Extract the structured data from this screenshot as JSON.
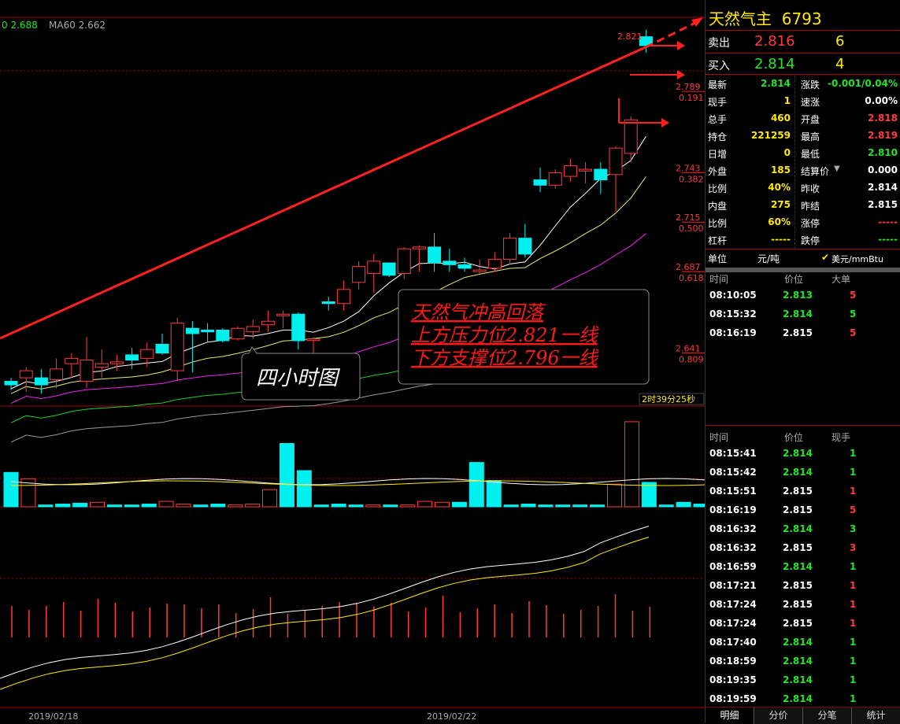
{
  "main_chart": {
    "ma_legend": [
      {
        "label": "0 2.688",
        "color": "#27e327"
      },
      {
        "label": "MA60 2.662",
        "color": "#aaaaaa"
      }
    ],
    "candles": [
      {
        "o": 2.624,
        "h": 2.626,
        "l": 2.619,
        "c": 2.622
      },
      {
        "o": 2.626,
        "h": 2.632,
        "l": 2.618,
        "c": 2.63
      },
      {
        "o": 2.626,
        "h": 2.631,
        "l": 2.617,
        "c": 2.622
      },
      {
        "o": 2.625,
        "h": 2.637,
        "l": 2.62,
        "c": 2.631
      },
      {
        "o": 2.634,
        "h": 2.64,
        "l": 2.626,
        "c": 2.637
      },
      {
        "o": 2.624,
        "h": 2.649,
        "l": 2.62,
        "c": 2.636
      },
      {
        "o": 2.632,
        "h": 2.642,
        "l": 2.626,
        "c": 2.634
      },
      {
        "o": 2.634,
        "h": 2.639,
        "l": 2.63,
        "c": 2.635
      },
      {
        "o": 2.639,
        "h": 2.643,
        "l": 2.631,
        "c": 2.636
      },
      {
        "o": 2.637,
        "h": 2.646,
        "l": 2.632,
        "c": 2.642
      },
      {
        "o": 2.645,
        "h": 2.651,
        "l": 2.639,
        "c": 2.64
      },
      {
        "o": 2.63,
        "h": 2.66,
        "l": 2.624,
        "c": 2.657
      },
      {
        "o": 2.654,
        "h": 2.658,
        "l": 2.629,
        "c": 2.651
      },
      {
        "o": 2.653,
        "h": 2.657,
        "l": 2.646,
        "c": 2.652
      },
      {
        "o": 2.653,
        "h": 2.654,
        "l": 2.646,
        "c": 2.647
      },
      {
        "o": 2.648,
        "h": 2.655,
        "l": 2.647,
        "c": 2.654
      },
      {
        "o": 2.652,
        "h": 2.659,
        "l": 2.648,
        "c": 2.655
      },
      {
        "o": 2.656,
        "h": 2.664,
        "l": 2.652,
        "c": 2.658
      },
      {
        "o": 2.662,
        "h": 2.664,
        "l": 2.654,
        "c": 2.662
      },
      {
        "o": 2.662,
        "h": 2.663,
        "l": 2.642,
        "c": 2.647
      },
      {
        "o": 2.648,
        "h": 2.649,
        "l": 2.639,
        "c": 2.648
      },
      {
        "o": 2.669,
        "h": 2.672,
        "l": 2.664,
        "c": 2.668
      },
      {
        "o": 2.668,
        "h": 2.681,
        "l": 2.664,
        "c": 2.676
      },
      {
        "o": 2.68,
        "h": 2.692,
        "l": 2.676,
        "c": 2.689
      },
      {
        "o": 2.685,
        "h": 2.696,
        "l": 2.674,
        "c": 2.692
      },
      {
        "o": 2.691,
        "h": 2.69,
        "l": 2.683,
        "c": 2.684
      },
      {
        "o": 2.685,
        "h": 2.7,
        "l": 2.682,
        "c": 2.699
      },
      {
        "o": 2.699,
        "h": 2.701,
        "l": 2.686,
        "c": 2.7
      },
      {
        "o": 2.7,
        "h": 2.708,
        "l": 2.686,
        "c": 2.691
      },
      {
        "o": 2.692,
        "h": 2.699,
        "l": 2.686,
        "c": 2.69
      },
      {
        "o": 2.69,
        "h": 2.694,
        "l": 2.686,
        "c": 2.688
      },
      {
        "o": 2.687,
        "h": 2.693,
        "l": 2.685,
        "c": 2.687
      },
      {
        "o": 2.688,
        "h": 2.697,
        "l": 2.686,
        "c": 2.693
      },
      {
        "o": 2.693,
        "h": 2.708,
        "l": 2.69,
        "c": 2.705
      },
      {
        "o": 2.705,
        "h": 2.713,
        "l": 2.694,
        "c": 2.696
      },
      {
        "o": 2.738,
        "h": 2.745,
        "l": 2.731,
        "c": 2.735
      },
      {
        "o": 2.735,
        "h": 2.744,
        "l": 2.733,
        "c": 2.742
      },
      {
        "o": 2.74,
        "h": 2.75,
        "l": 2.737,
        "c": 2.746
      },
      {
        "o": 2.743,
        "h": 2.748,
        "l": 2.736,
        "c": 2.744
      },
      {
        "o": 2.744,
        "h": 2.748,
        "l": 2.73,
        "c": 2.738
      },
      {
        "o": 2.741,
        "h": 2.757,
        "l": 2.72,
        "c": 2.756
      },
      {
        "o": 2.753,
        "h": 2.774,
        "l": 2.748,
        "c": 2.772
      },
      {
        "o": 2.819,
        "h": 2.823,
        "l": 2.81,
        "c": 2.814
      }
    ],
    "price_labels": [
      {
        "price": 2.821,
        "label": "2.821"
      },
      {
        "price": 2.789,
        "label": "2.789",
        "sub": "0.191"
      },
      {
        "price": 2.743,
        "label": "2.743",
        "sub": "0.382"
      },
      {
        "price": 2.715,
        "label": "2.715",
        "sub": "0.500"
      },
      {
        "price": 2.687,
        "label": "2.687",
        "sub": "0.618"
      },
      {
        "price": 2.641,
        "label": "2.641",
        "sub": "0.809"
      }
    ],
    "annotation_box": {
      "lines": [
        "天然气冲高回落",
        "上方压力位2.821一线",
        "下方支撑位2.796一线"
      ]
    },
    "callout": "四小时图",
    "countdown": "2时39分25秒",
    "date_labels": [
      "2019/02/18",
      "2019/02/22"
    ]
  },
  "volume": {
    "bars": [
      38,
      31,
      2,
      3,
      4,
      5,
      2,
      2,
      3,
      6,
      3,
      2,
      3,
      2,
      3,
      19,
      70,
      40,
      2,
      3,
      2,
      2,
      2,
      2,
      6,
      5,
      5,
      49,
      29,
      2,
      3,
      2,
      2,
      2,
      2,
      25,
      94,
      27,
      2,
      5,
      3,
      2,
      4,
      53,
      30,
      5,
      3,
      3,
      2,
      4,
      43,
      68,
      54,
      4
    ]
  },
  "panel": {
    "title": "天然气主",
    "code": "6793",
    "sell": {
      "label": "卖出",
      "price": "2.816",
      "qty": "6"
    },
    "buy": {
      "label": "买入",
      "price": "2.814",
      "qty": "4"
    },
    "stats": [
      {
        "k1": "最新",
        "v1": "2.814",
        "c1": "green",
        "k2": "涨跌",
        "v2": "-0.001/0.04%",
        "c2": "green"
      },
      {
        "k1": "现手",
        "v1": "1",
        "c1": "yellow",
        "k2": "速涨",
        "v2": "0.00%",
        "c2": "white"
      },
      {
        "k1": "总手",
        "v1": "460",
        "c1": "yellow",
        "k2": "开盘",
        "v2": "2.818",
        "c2": "red"
      },
      {
        "k1": "持仓",
        "v1": "221259",
        "c1": "yellow",
        "k2": "最高",
        "v2": "2.819",
        "c2": "red"
      },
      {
        "k1": "日增",
        "v1": "0",
        "c1": "yellow",
        "k2": "最低",
        "v2": "2.810",
        "c2": "green"
      },
      {
        "k1": "外盘",
        "v1": "185",
        "c1": "yellow",
        "k2": "结算价",
        "v2": "0.000",
        "c2": "white"
      },
      {
        "k1": "比例",
        "v1": "40%",
        "c1": "yellow",
        "k2": "昨收",
        "v2": "2.814",
        "c2": "white"
      },
      {
        "k1": "内盘",
        "v1": "275",
        "c1": "yellow",
        "k2": "昨结",
        "v2": "2.815",
        "c2": "white"
      },
      {
        "k1": "比例",
        "v1": "60%",
        "c1": "yellow",
        "k2": "涨停",
        "v2": "-----",
        "c2": "red"
      },
      {
        "k1": "杠杆",
        "v1": "-----",
        "c1": "yellow",
        "k2": "跌停",
        "v2": "-----",
        "c2": "green"
      }
    ],
    "unit_label": "单位",
    "unit_value": "元/吨",
    "unit_alt": "美元/mmBtu",
    "big_orders": {
      "headers": [
        "时间",
        "价位",
        "大单"
      ],
      "rows": [
        {
          "time": "08:10:05",
          "price": "2.813",
          "pc": "green",
          "qty": "5",
          "qc": "red"
        },
        {
          "time": "08:15:32",
          "price": "2.814",
          "pc": "green",
          "qty": "5",
          "qc": "green"
        },
        {
          "time": "08:16:19",
          "price": "2.815",
          "pc": "white",
          "qty": "5",
          "qc": "red"
        }
      ]
    },
    "ticks": {
      "headers": [
        "时间",
        "价位",
        "现手"
      ],
      "rows": [
        {
          "time": "08:15:41",
          "price": "2.814",
          "pc": "green",
          "qty": "1",
          "qc": "green"
        },
        {
          "time": "08:15:42",
          "price": "2.814",
          "pc": "green",
          "qty": "1",
          "qc": "green"
        },
        {
          "time": "08:15:51",
          "price": "2.815",
          "pc": "white",
          "qty": "1",
          "qc": "red"
        },
        {
          "time": "08:16:19",
          "price": "2.815",
          "pc": "white",
          "qty": "5",
          "qc": "red"
        },
        {
          "time": "08:16:32",
          "price": "2.814",
          "pc": "green",
          "qty": "3",
          "qc": "green"
        },
        {
          "time": "08:16:32",
          "price": "2.815",
          "pc": "white",
          "qty": "3",
          "qc": "red"
        },
        {
          "time": "08:16:59",
          "price": "2.814",
          "pc": "green",
          "qty": "1",
          "qc": "green"
        },
        {
          "time": "08:17:21",
          "price": "2.815",
          "pc": "white",
          "qty": "1",
          "qc": "red"
        },
        {
          "time": "08:17:24",
          "price": "2.815",
          "pc": "white",
          "qty": "1",
          "qc": "red"
        },
        {
          "time": "08:17:24",
          "price": "2.815",
          "pc": "white",
          "qty": "1",
          "qc": "red"
        },
        {
          "time": "08:17:40",
          "price": "2.814",
          "pc": "green",
          "qty": "1",
          "qc": "green"
        },
        {
          "time": "08:18:59",
          "price": "2.814",
          "pc": "green",
          "qty": "1",
          "qc": "green"
        },
        {
          "time": "08:19:35",
          "price": "2.814",
          "pc": "green",
          "qty": "1",
          "qc": "green"
        },
        {
          "time": "08:19:59",
          "price": "2.814",
          "pc": "green",
          "qty": "1",
          "qc": "green"
        }
      ]
    },
    "tabs": [
      "明细",
      "分价",
      "分笔",
      "统计"
    ]
  }
}
